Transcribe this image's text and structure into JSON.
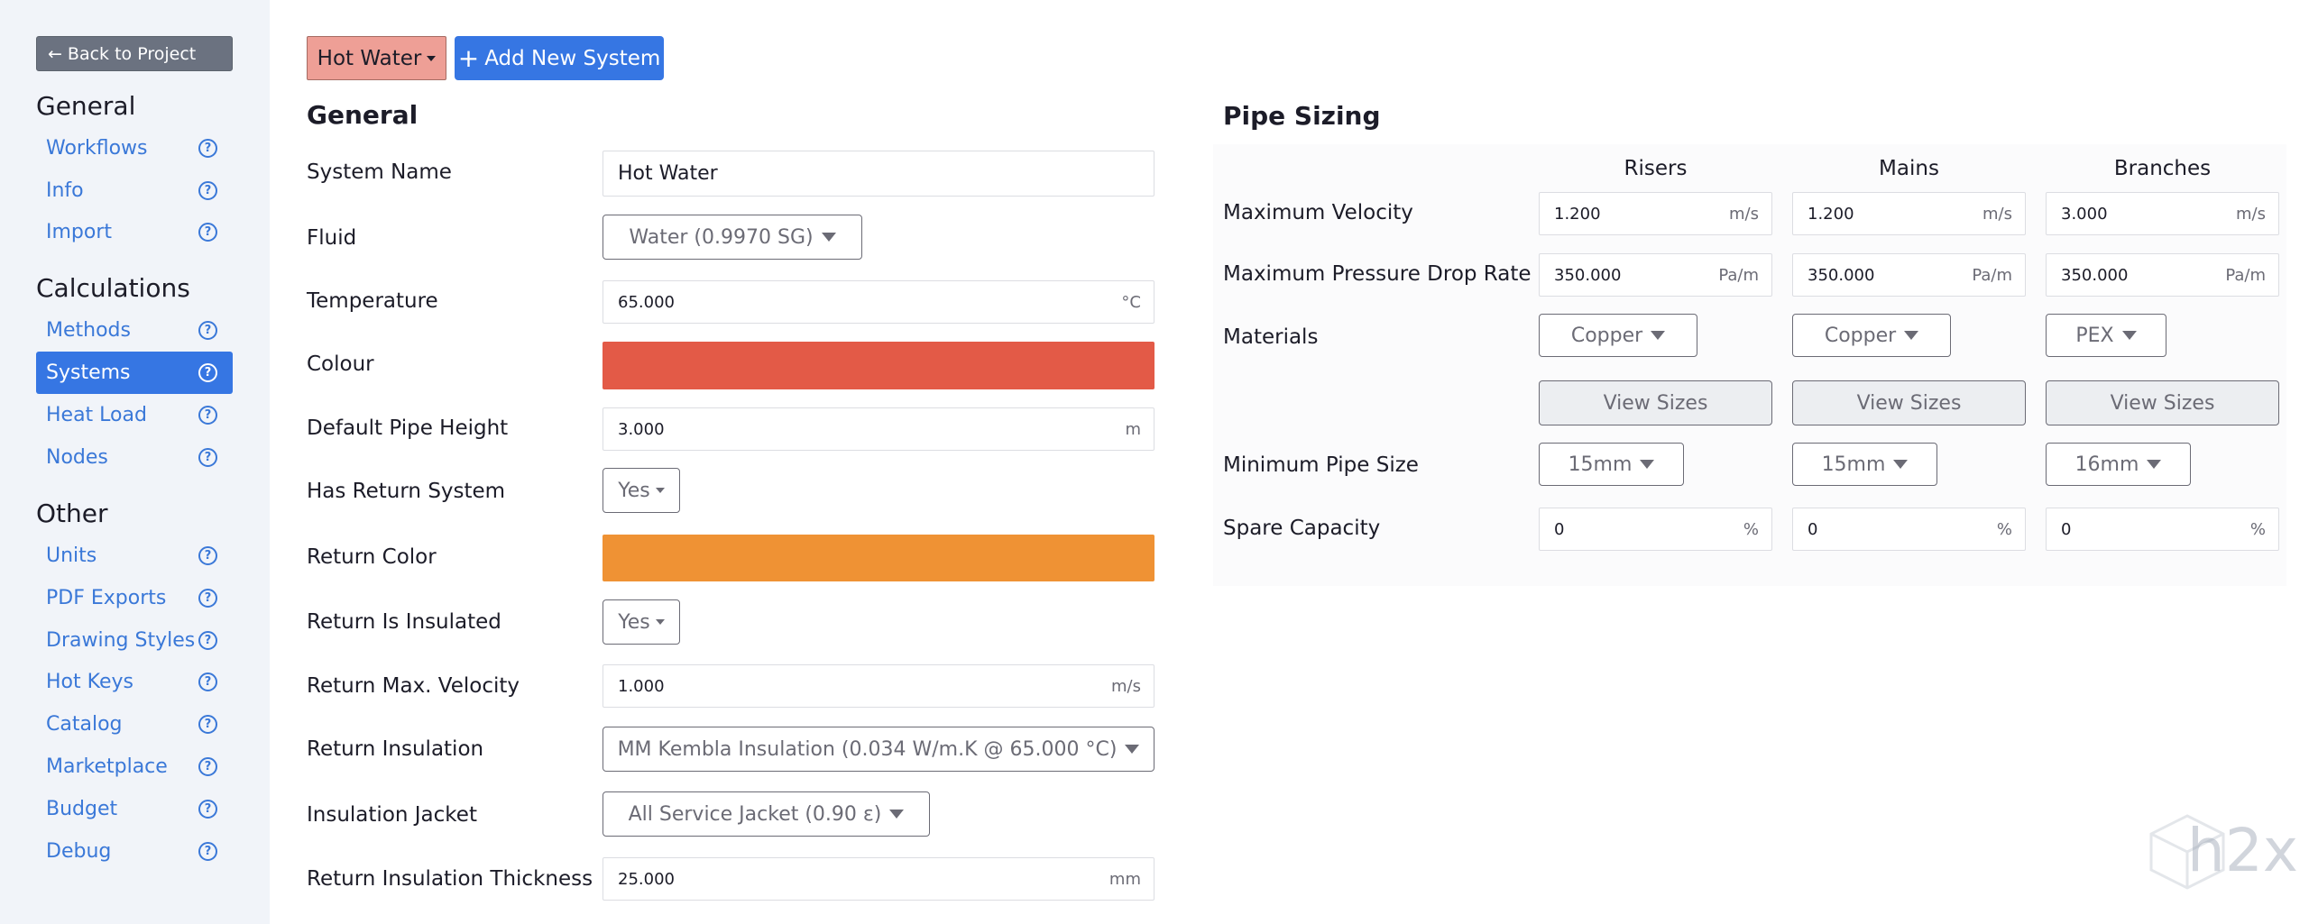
{
  "sidebar": {
    "back_label": "Back to Project",
    "sections": [
      {
        "heading": "General",
        "items": [
          {
            "label": "Workflows"
          },
          {
            "label": "Info"
          },
          {
            "label": "Import"
          }
        ]
      },
      {
        "heading": "Calculations",
        "items": [
          {
            "label": "Methods"
          },
          {
            "label": "Systems"
          },
          {
            "label": "Heat Load"
          },
          {
            "label": "Nodes"
          }
        ]
      },
      {
        "heading": "Other",
        "items": [
          {
            "label": "Units"
          },
          {
            "label": "PDF Exports"
          },
          {
            "label": "Drawing Styles"
          },
          {
            "label": "Hot Keys"
          },
          {
            "label": "Catalog"
          },
          {
            "label": "Marketplace"
          },
          {
            "label": "Budget"
          },
          {
            "label": "Debug"
          }
        ]
      }
    ],
    "help_glyph": "?",
    "active_item": "Systems"
  },
  "toolbar": {
    "system_select": "Hot Water",
    "add_label": "Add New System"
  },
  "general": {
    "title": "General",
    "fields": {
      "system_name": {
        "label": "System Name",
        "value": "Hot Water"
      },
      "fluid": {
        "label": "Fluid",
        "value": "Water (0.9970 SG)"
      },
      "temperature": {
        "label": "Temperature",
        "value": "65.000",
        "unit": "°C"
      },
      "colour": {
        "label": "Colour",
        "color": "#e35a47"
      },
      "pipe_height": {
        "label": "Default Pipe Height",
        "value": "3.000",
        "unit": "m"
      },
      "has_return": {
        "label": "Has Return System",
        "value": "Yes"
      },
      "return_color": {
        "label": "Return Color",
        "color": "#ef9234"
      },
      "return_insulated": {
        "label": "Return Is Insulated",
        "value": "Yes"
      },
      "return_velocity": {
        "label": "Return Max. Velocity",
        "value": "1.000",
        "unit": "m/s"
      },
      "return_insulation": {
        "label": "Return Insulation",
        "value": "MM Kembla Insulation (0.034 W/m.K @ 65.000 °C)"
      },
      "insulation_jacket": {
        "label": "Insulation Jacket",
        "value": "All Service Jacket (0.90 ε)"
      },
      "insulation_thickness": {
        "label": "Return Insulation Thickness",
        "value": "25.000",
        "unit": "mm"
      }
    }
  },
  "pipe_sizing": {
    "title": "Pipe Sizing",
    "columns": [
      "Risers",
      "Mains",
      "Branches"
    ],
    "rows": {
      "max_velocity": {
        "label": "Maximum Velocity",
        "values": [
          "1.200",
          "1.200",
          "3.000"
        ],
        "unit": "m/s"
      },
      "max_pressure": {
        "label": "Maximum Pressure Drop Rate",
        "values": [
          "350.000",
          "350.000",
          "350.000"
        ],
        "unit": "Pa/m"
      },
      "materials": {
        "label": "Materials",
        "values": [
          "Copper",
          "Copper",
          "PEX"
        ]
      },
      "view_sizes": {
        "label": "View Sizes"
      },
      "min_pipe_size": {
        "label": "Minimum Pipe Size",
        "values": [
          "15mm",
          "15mm",
          "16mm"
        ]
      },
      "spare_capacity": {
        "label": "Spare Capacity",
        "values": [
          "0",
          "0",
          "0"
        ],
        "unit": "%"
      }
    }
  },
  "watermark": {
    "text": "h2x"
  }
}
